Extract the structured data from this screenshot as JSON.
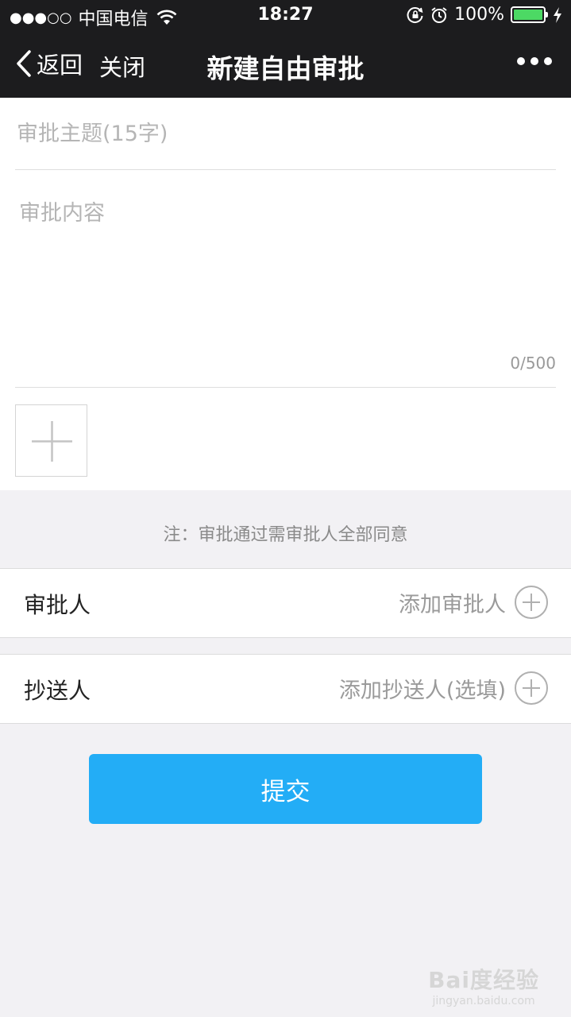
{
  "status_bar": {
    "signal": "●●●○○",
    "carrier": "中国电信",
    "time": "18:27",
    "battery": "100%",
    "battery_level": 1.0,
    "battery_color": "#4cd964"
  },
  "nav": {
    "back_label": "返回",
    "close_label": "关闭",
    "title": "新建自由审批",
    "more_icon": "more-dots-icon"
  },
  "form": {
    "subject_placeholder": "审批主题(15字)",
    "subject_value": "",
    "content_placeholder": "审批内容",
    "content_value": "",
    "counter": "0/500",
    "attachment_icon": "plus-icon"
  },
  "note": "注：审批通过需审批人全部同意",
  "approver": {
    "label": "审批人",
    "action": "添加审批人",
    "icon": "add-circle-icon"
  },
  "cc": {
    "label": "抄送人",
    "action": "添加抄送人(选填)",
    "icon": "add-circle-icon"
  },
  "submit_label": "提交",
  "colors": {
    "accent": "#23adf6",
    "bar": "#1c1c1e",
    "background": "#f2f1f4"
  },
  "watermark": {
    "logo": "Bai度经验",
    "url": "jingyan.baidu.com"
  }
}
